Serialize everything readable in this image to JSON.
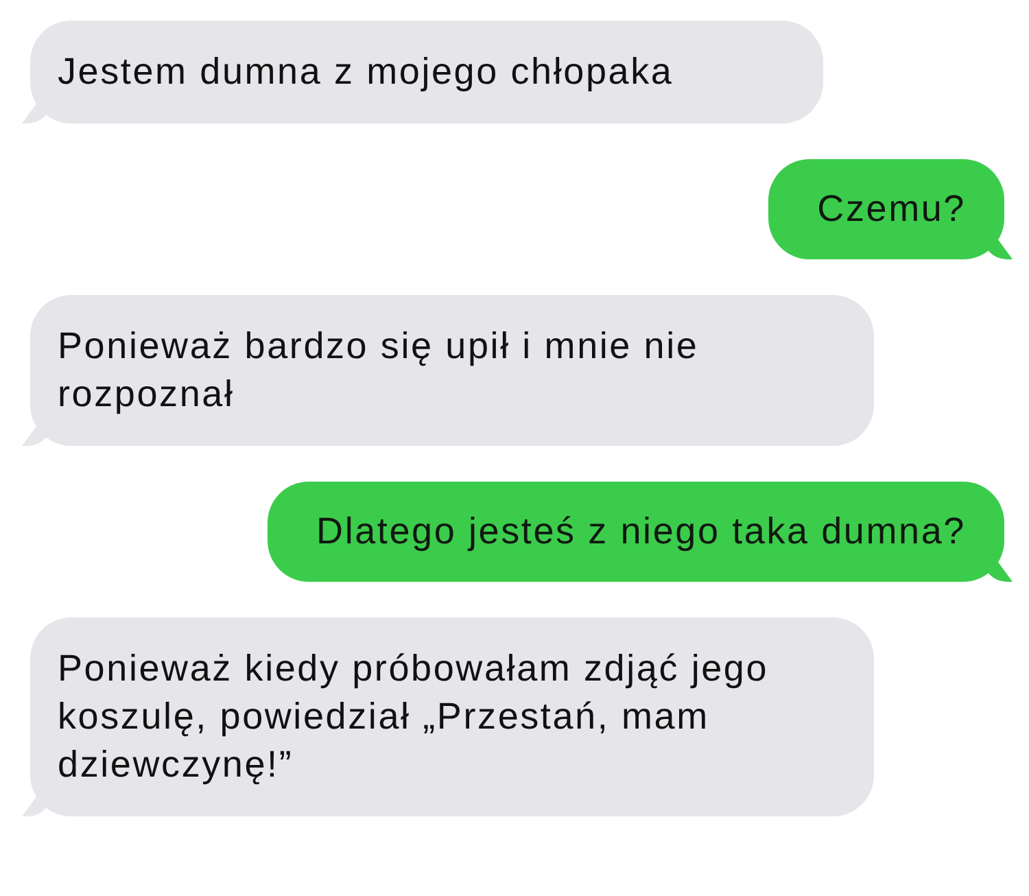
{
  "messages": [
    {
      "kind": "received",
      "text": "Jestem dumna z mojego chłopaka"
    },
    {
      "kind": "sent",
      "text": "Czemu?"
    },
    {
      "kind": "received",
      "text": "Ponieważ bardzo się upił i mnie nie rozpoznał"
    },
    {
      "kind": "sent",
      "text": "Dlatego jesteś z niego taka dumna?"
    },
    {
      "kind": "received",
      "text": "Ponieważ kiedy próbowałam zdjąć jego koszulę, powiedział „Przestań, mam dziewczynę!”"
    }
  ]
}
